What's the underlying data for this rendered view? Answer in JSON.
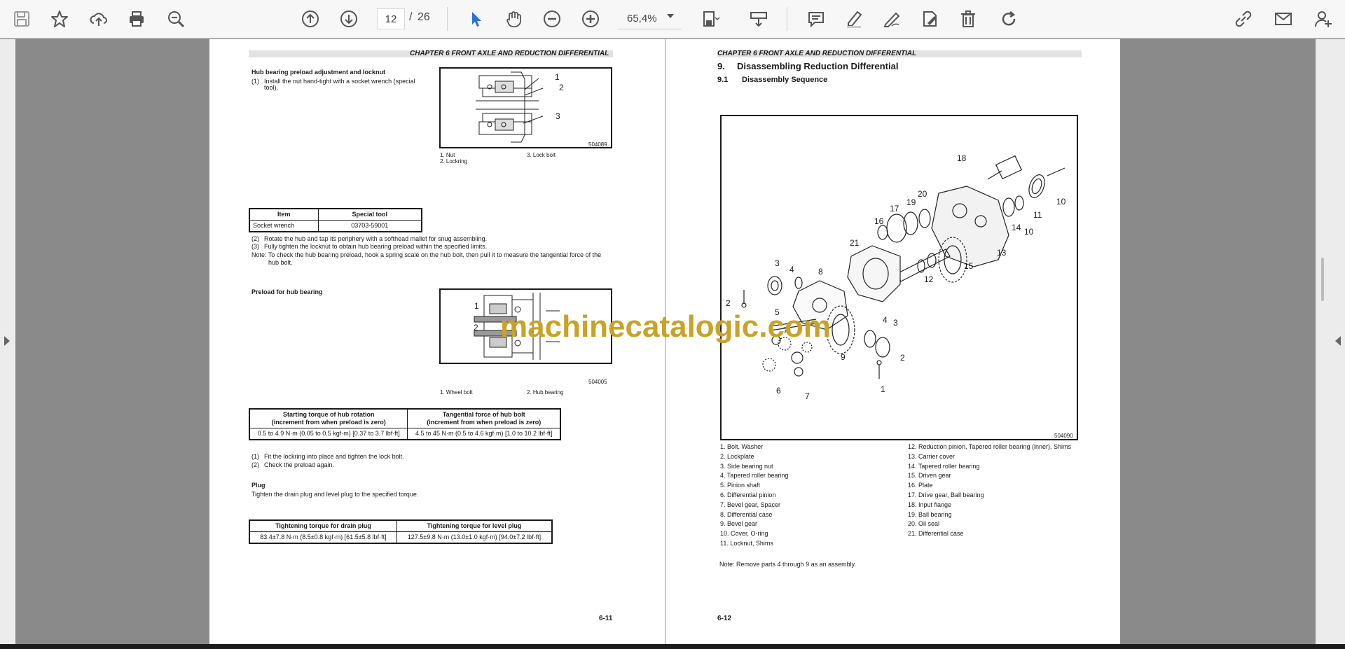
{
  "toolbar": {
    "page_current": "12",
    "page_separator": "/",
    "page_total": "26",
    "zoom": "65,4%",
    "icons": [
      "save-icon",
      "star-icon",
      "upload-cloud-icon",
      "print-icon",
      "search-zoom-icon",
      "page-up-icon",
      "page-down-icon",
      "select-cursor-icon",
      "hand-pan-icon",
      "zoom-out-icon",
      "zoom-in-icon",
      "page-view-icon",
      "scroll-mode-icon",
      "comment-icon",
      "highlight-pen-icon",
      "draw-icon",
      "fill-sign-icon",
      "delete-icon",
      "rotate-icon",
      "link-icon",
      "mail-icon",
      "add-user-icon"
    ]
  },
  "left_page": {
    "chapter_title": "CHAPTER 6 FRONT AXLE AND REDUCTION DIFFERENTIAL",
    "section1_heading": "Hub bearing preload adjustment and locknut",
    "step1_num": "(1)",
    "step1_text": "Install the nut hand-tight with a socket wrench (special",
    "step1_text_cont": "tool).",
    "fig1_callouts": [
      "1",
      "2",
      "3"
    ],
    "fig1_code": "504089",
    "fig1_legend_1": "1.  Nut",
    "fig1_legend_2": "2.  Lockring",
    "fig1_legend_3": "3.  Lock bolt",
    "tool_table": {
      "headers": [
        "Item",
        "Special tool"
      ],
      "rows": [
        [
          "Socket wrench",
          "03703-59001"
        ]
      ]
    },
    "step2_num": "(2)",
    "step2_text": "Rotate the hub and tap its periphery with a softhead mallet for snug assembling.",
    "step3_num": "(3)",
    "step3_text": "Fully tighten the locknut to obtain hub bearing preload within the specified limits.",
    "note1": "Note: To check the hub bearing preload, hook a spring scale on the hub bolt, then pull it to measure the tangential force of the",
    "note1_cont": "hub bolt.",
    "section2_heading": "Preload for hub bearing",
    "fig2_callouts": [
      "1",
      "2"
    ],
    "fig2_code": "504005",
    "fig2_legend_1": "1.  Wheel bolt",
    "fig2_legend_2": "2.  Hub bearing",
    "preload_table": {
      "headers": [
        "Starting torque of hub rotation",
        "Tangential force of hub bolt"
      ],
      "headers_sub": [
        "(increment from when preload is zero)",
        "(increment from when preload is zero)"
      ],
      "rows": [
        [
          "0.5 to 4.9 N·m (0.05 to 0.5 kgf·m) [0.37 to 3.7 lbf·ft]",
          "4.5 to 45 N·m (0.5 to 4.6 kgf·m) [1.0 to 10.2 lbf·ft]"
        ]
      ]
    },
    "step4_num": "(1)",
    "step4_text": "Fit the lockring into place and tighten the lock bolt.",
    "step5_num": "(2)",
    "step5_text": "Check the preload again.",
    "section3_heading": "Plug",
    "plug_text": "Tighten the drain plug and level plug to the specified torque.",
    "plug_table": {
      "headers": [
        "Tightening torque for drain plug",
        "Tightening torque for level plug"
      ],
      "rows": [
        [
          "83.4±7.8 N·m (8.5±0.8 kgf·m) [61.5±5.8 lbf·ft]",
          "127.5±9.8 N·m (13.0±1.0 kgf·m) [94.0±7.2 lbf·ft]"
        ]
      ]
    },
    "page_number": "6-11"
  },
  "right_page": {
    "chapter_title": "CHAPTER 6 FRONT AXLE AND REDUCTION DIFFERENTIAL",
    "heading_num": "9.",
    "heading": "Disassembling Reduction Differential",
    "subheading_num": "9.1",
    "subheading": "Disassembly Sequence",
    "fig_code": "504090",
    "fig_callouts": [
      "18",
      "20",
      "17",
      "19",
      "16",
      "10",
      "11",
      "14",
      "10",
      "13",
      "21",
      "15",
      "12",
      "3",
      "4",
      "8",
      "2",
      "5",
      "4",
      "3",
      "7",
      "9",
      "2",
      "6",
      "7",
      "1"
    ],
    "legend_left": [
      "1.     Bolt, Washer",
      "2.     Lockplate",
      "3.     Side bearing nut",
      "4.     Tapered roller bearing",
      "5.     Pinion shaft",
      "6.     Differential pinion",
      "7.     Bevel gear, Spacer",
      "8.     Differential case",
      "9.     Bevel gear",
      "10.   Cover, O-ring",
      "11.   Locknut, Shims"
    ],
    "legend_right": [
      "12.   Reduction pinion, Tapered roller bearing (inner), Shims",
      "13.   Carrier cover",
      "14.   Tapered roller bearing",
      "15.   Driven gear",
      "16.   Plate",
      "17.   Drive gear, Ball bearing",
      "18.   Input flange",
      "19.   Ball bearing",
      "20.   Oil seal",
      "21.   Differential case"
    ],
    "note": "Note: Remove parts 4 through 9 as an assembly.",
    "page_number": "6-12"
  },
  "watermark": "machinecatalogic.com"
}
